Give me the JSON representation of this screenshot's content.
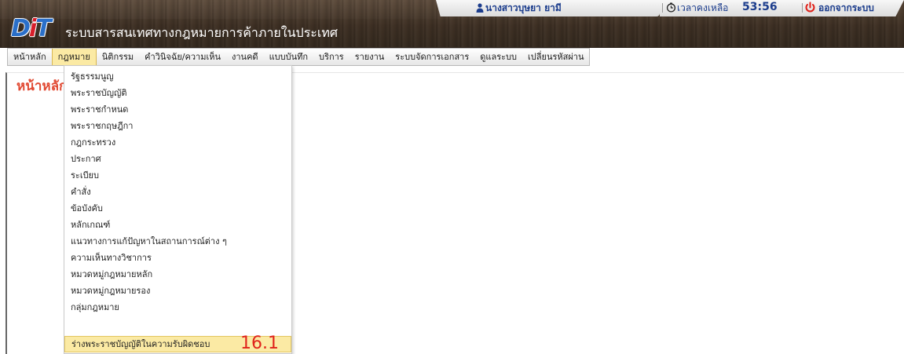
{
  "header": {
    "logo_text_left": "D",
    "logo_text_mid": "i",
    "logo_text_right": "T",
    "system_title": "ระบบสารสนเทศทางกฎหมายการค้าภายในประเทศ",
    "user_name": "นางสาวบุษยา ยามี",
    "timer_label": "เวลาคงเหลือ",
    "timer_value": "53:56",
    "logout_label": "ออกจากระบบ"
  },
  "menu": {
    "items": [
      {
        "label": "หน้าหลัก"
      },
      {
        "label": "กฎหมาย",
        "active": true
      },
      {
        "label": "นิติกรรม"
      },
      {
        "label": "คำวินิจฉัย/ความเห็น"
      },
      {
        "label": "งานคดี"
      },
      {
        "label": "แบบบันทึก"
      },
      {
        "label": "บริการ"
      },
      {
        "label": "รายงาน"
      },
      {
        "label": "ระบบจัดการเอกสาร"
      },
      {
        "label": "ดูแลระบบ"
      },
      {
        "label": "เปลี่ยนรหัสผ่าน"
      }
    ]
  },
  "page": {
    "title": "หน้าหลัก"
  },
  "dropdown": {
    "items": [
      {
        "label": "รัฐธรรมนูญ"
      },
      {
        "label": "พระราชบัญญัติ"
      },
      {
        "label": "พระราชกำหนด"
      },
      {
        "label": "พระราชกฤษฎีกา"
      },
      {
        "label": "กฎกระทรวง"
      },
      {
        "label": "ประกาศ"
      },
      {
        "label": "ระเบียบ"
      },
      {
        "label": "คำสั่ง"
      },
      {
        "label": "ข้อบังคับ"
      },
      {
        "label": "หลักเกณฑ์"
      },
      {
        "label": "แนวทางการแก้ปัญหาในสถานการณ์ต่าง ๆ"
      },
      {
        "label": "ความเห็นทางวิชาการ"
      },
      {
        "label": "หมวดหมู่กฎหมายหลัก"
      },
      {
        "label": "หมวดหมู่กฎหมายรอง"
      },
      {
        "label": "กลุ่มกฎหมาย"
      },
      {
        "label": "ร่างพระราชบัญญัติในความรับผิดชอบ",
        "highlighted": true
      }
    ],
    "step_annotation": "16.1"
  },
  "colors": {
    "accent_highlight": "#fbeaa4",
    "page_title": "#e14a33",
    "header_text": "#1b3c8c",
    "annotation": "#e0231b"
  }
}
